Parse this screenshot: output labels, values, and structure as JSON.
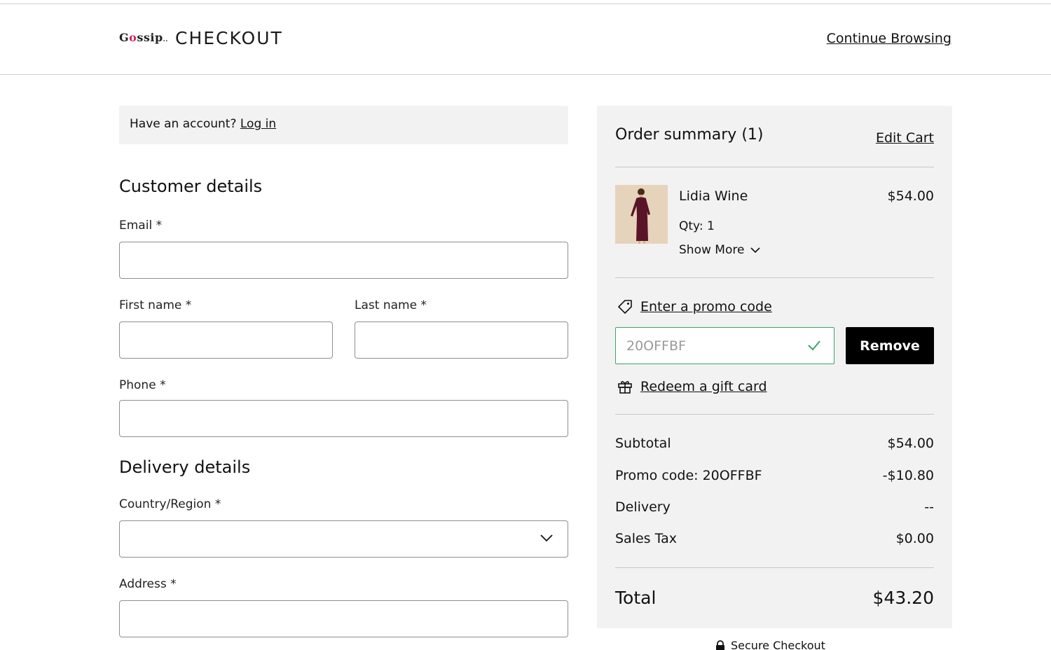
{
  "header": {
    "logo_text": "Gossip",
    "title": "CHECKOUT",
    "continue_label": "Continue Browsing"
  },
  "account": {
    "prompt": "Have an account?",
    "login_label": "Log in"
  },
  "customer": {
    "title": "Customer details",
    "email_label": "Email *",
    "first_name_label": "First name *",
    "last_name_label": "Last name *",
    "phone_label": "Phone *",
    "email_value": "",
    "first_name_value": "",
    "last_name_value": "",
    "phone_value": ""
  },
  "delivery": {
    "title": "Delivery details",
    "country_label": "Country/Region *",
    "country_value": "",
    "address_label": "Address *",
    "address_value": ""
  },
  "summary": {
    "title": "Order summary (1)",
    "edit_cart_label": "Edit Cart",
    "item": {
      "name": "Lidia Wine",
      "price": "$54.00",
      "qty": "Qty: 1",
      "show_more": "Show More"
    },
    "promo_link": "Enter a promo code",
    "promo_value": "20OFFBF",
    "remove_label": "Remove",
    "gift_link": "Redeem a gift card",
    "lines": [
      {
        "label": "Subtotal",
        "value": "$54.00"
      },
      {
        "label": "Promo code: 20OFFBF",
        "value": "-$10.80"
      },
      {
        "label": "Delivery",
        "value": "--"
      },
      {
        "label": "Sales Tax",
        "value": "$0.00"
      }
    ],
    "total_label": "Total",
    "total_value": "$43.20"
  },
  "footer": {
    "secure_label": "Secure Checkout"
  },
  "colors": {
    "promo_valid": "#3aa36d",
    "button": "#000000",
    "panel": "#f2f2f2"
  }
}
